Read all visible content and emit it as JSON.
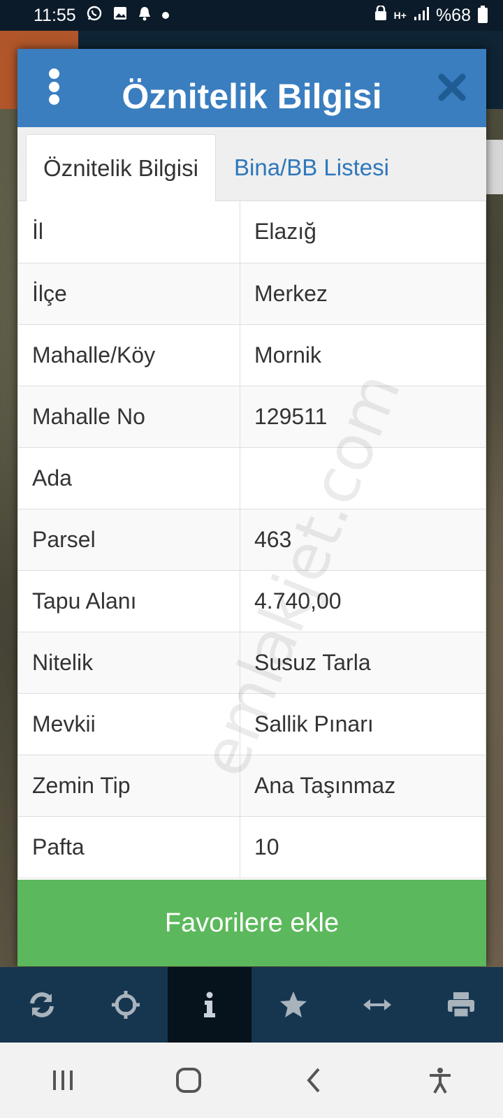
{
  "status_bar": {
    "time": "11:55",
    "battery": "%68",
    "network": "H+"
  },
  "dialog": {
    "title": "Öznitelik Bilgisi",
    "tabs": [
      {
        "label": "Öznitelik Bilgisi",
        "active": true
      },
      {
        "label": "Bina/BB Listesi",
        "active": false
      }
    ],
    "rows": [
      {
        "key": "İl",
        "value": "Elazığ"
      },
      {
        "key": "İlçe",
        "value": "Merkez"
      },
      {
        "key": "Mahalle/Köy",
        "value": "Mornik"
      },
      {
        "key": "Mahalle No",
        "value": "129511"
      },
      {
        "key": "Ada",
        "value": ""
      },
      {
        "key": "Parsel",
        "value": "463"
      },
      {
        "key": "Tapu Alanı",
        "value": "4.740,00"
      },
      {
        "key": "Nitelik",
        "value": "Susuz Tarla"
      },
      {
        "key": "Mevkii",
        "value": "Sallik Pınarı"
      },
      {
        "key": "Zemin Tip",
        "value": "Ana Taşınmaz"
      },
      {
        "key": "Pafta",
        "value": "10"
      }
    ],
    "favorite_button": "Favorilere ekle"
  },
  "watermark": "emlakjet.com",
  "toolbar": {
    "items": [
      "refresh-icon",
      "locate-icon",
      "info-icon",
      "star-icon",
      "measure-icon",
      "print-icon"
    ],
    "active_index": 2
  },
  "colors": {
    "header": "#3a7ebf",
    "tab_link": "#2e77bb",
    "favorite": "#5cb85c",
    "toolbar": "#163650"
  }
}
